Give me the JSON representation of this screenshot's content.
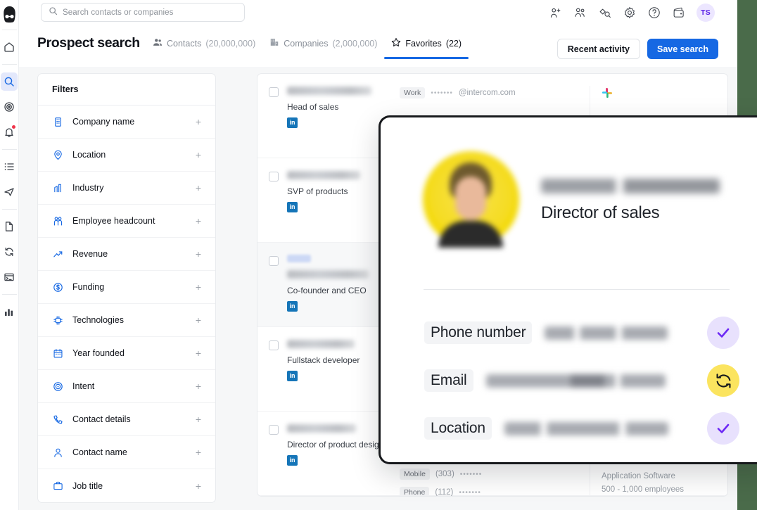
{
  "search": {
    "placeholder": "Search contacts or companies"
  },
  "rail": {
    "logo_icon": "person-logo-icon",
    "items": [
      {
        "icon": "home-icon",
        "name": "home",
        "active": false,
        "badge": false
      },
      {
        "icon": "search-icon",
        "name": "search",
        "active": true,
        "badge": false
      },
      {
        "icon": "target-icon",
        "name": "intent",
        "active": false,
        "badge": false
      },
      {
        "icon": "bell-icon",
        "name": "notifications",
        "active": false,
        "badge": true
      },
      {
        "icon": "list-icon",
        "name": "lists",
        "active": false,
        "badge": false
      },
      {
        "icon": "send-icon",
        "name": "campaigns",
        "active": false,
        "badge": false
      },
      {
        "icon": "document-icon",
        "name": "documents",
        "active": false,
        "badge": false
      },
      {
        "icon": "refresh-icon",
        "name": "sync",
        "active": false,
        "badge": false
      },
      {
        "icon": "terminal-icon",
        "name": "console",
        "active": false,
        "badge": false
      },
      {
        "icon": "bar-chart-icon",
        "name": "analytics",
        "active": false,
        "badge": false
      }
    ]
  },
  "topbar": {
    "icons": [
      "add-user-icon",
      "people-icon",
      "tag-icon",
      "gear-icon",
      "help-icon",
      "wallet-icon"
    ],
    "avatar_initials": "TS"
  },
  "header": {
    "title": "Prospect search",
    "tabs": [
      {
        "label": "Contacts",
        "count": "(20,000,000)",
        "icon": "contacts-icon",
        "active": false
      },
      {
        "label": "Companies",
        "count": "(2,000,000)",
        "icon": "building-icon",
        "active": false
      },
      {
        "label": "Favorites",
        "count": "(22)",
        "icon": "star-icon",
        "active": true
      }
    ],
    "recent_activity_label": "Recent activity",
    "save_search_label": "Save search",
    "accent_color": "#1668e3"
  },
  "filters": {
    "title": "Filters",
    "expand_glyph": "+",
    "items": [
      {
        "label": "Company name",
        "icon": "building-icon"
      },
      {
        "label": "Location",
        "icon": "pin-icon"
      },
      {
        "label": "Industry",
        "icon": "industry-icon"
      },
      {
        "label": "Employee headcount",
        "icon": "people-icon"
      },
      {
        "label": "Revenue",
        "icon": "trend-up-icon"
      },
      {
        "label": "Funding",
        "icon": "dollar-icon"
      },
      {
        "label": "Technologies",
        "icon": "chip-icon"
      },
      {
        "label": "Year founded",
        "icon": "calendar-icon"
      },
      {
        "label": "Intent",
        "icon": "target-icon"
      },
      {
        "label": "Contact details",
        "icon": "phone-icon"
      },
      {
        "label": "Contact name",
        "icon": "user-icon"
      },
      {
        "label": "Job title",
        "icon": "briefcase-icon"
      }
    ]
  },
  "results": {
    "rows": [
      {
        "title": "Head of sales",
        "linkedin": "in",
        "selected": false,
        "email_tag": "Work",
        "email_dots": "•••••••",
        "email_domain": "@intercom.com",
        "company_icon": "slack-icon"
      },
      {
        "title": "SVP of products",
        "linkedin": "in",
        "selected": false
      },
      {
        "title": "Co-founder and CEO",
        "linkedin": "in",
        "selected": true,
        "has_badge": true
      },
      {
        "title": "Fullstack developer",
        "linkedin": "in",
        "selected": false
      },
      {
        "title": "Director of product design",
        "linkedin": "in",
        "selected": false,
        "mobile_tag": "Mobile",
        "mobile_code": "(303)",
        "mobile_dots": "•••••••",
        "phone_tag": "Phone",
        "phone_code": "(112)",
        "phone_dots": "•••••••",
        "industry": "Application Software",
        "headcount": "500 - 1,000 employees"
      }
    ]
  },
  "modal": {
    "role": "Director of sales",
    "rows": [
      {
        "key": "Phone number",
        "action_icon": "check-icon",
        "action_style": "check"
      },
      {
        "key": "Email",
        "action_icon": "refresh-icon",
        "action_style": "sync"
      },
      {
        "key": "Location",
        "action_icon": "check-icon",
        "action_style": "check"
      }
    ],
    "check_color": "#6d28f5",
    "check_bg": "#e8e1fd",
    "sync_bg": "#fbe45f"
  }
}
